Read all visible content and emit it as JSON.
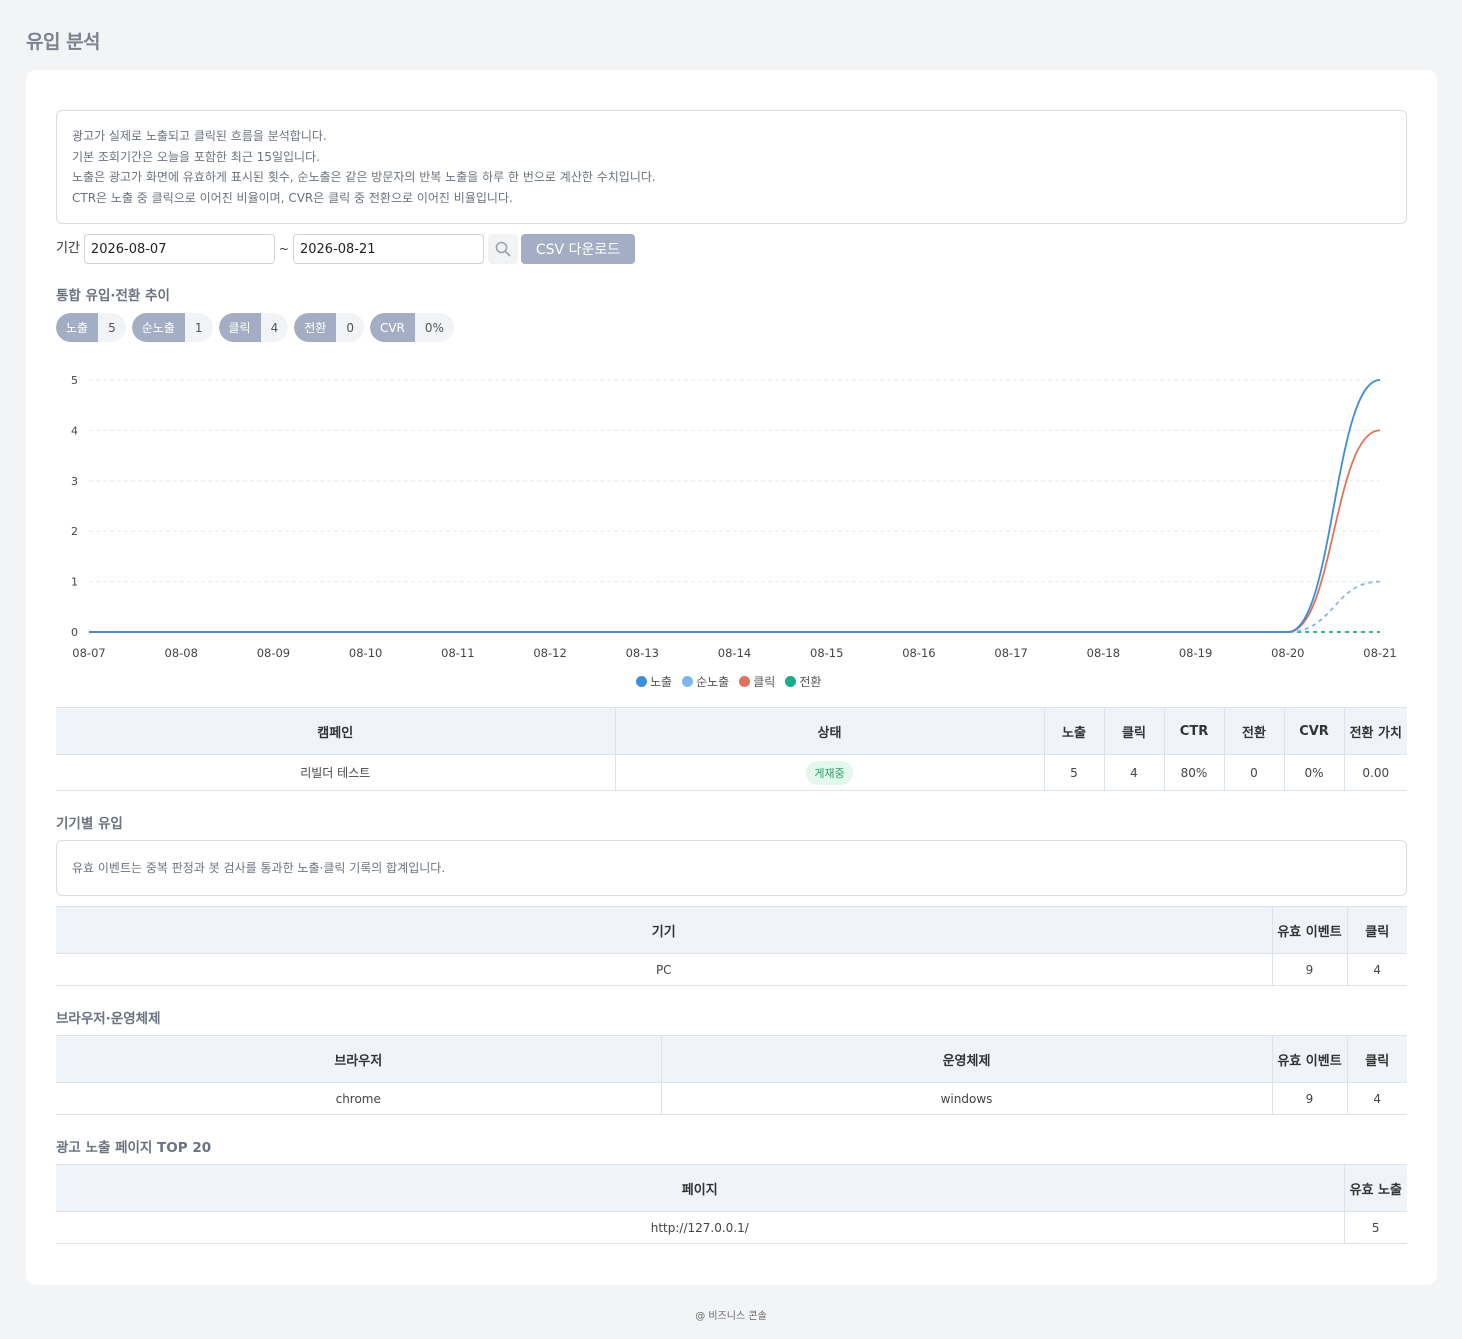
{
  "page_title": "유입 분석",
  "notice_lines": [
    "광고가 실제로 노출되고 클릭된 흐름을 분석합니다.",
    "기본 조회기간은 오늘을 포함한 최근 15일입니다.",
    "노출은 광고가 화면에 유효하게 표시된 횟수, 순노출은 같은 방문자의 반복 노출을 하루 한 번으로 계산한 수치입니다.",
    "CTR은 노출 중 클릭으로 이어진 비율이며, CVR은 클릭 중 전환으로 이어진 비율입니다."
  ],
  "filter": {
    "label": "기간",
    "start_date": "2026-08-07",
    "separator": "~",
    "end_date": "2026-08-21",
    "csv_label": "CSV 다운로드"
  },
  "trend": {
    "title": "통합 유입·전환 추이",
    "stats": [
      {
        "key": "노출",
        "value": "5"
      },
      {
        "key": "순노출",
        "value": "1"
      },
      {
        "key": "클릭",
        "value": "4"
      },
      {
        "key": "전환",
        "value": "0"
      },
      {
        "key": "CVR",
        "value": "0%"
      }
    ]
  },
  "chart_data": {
    "type": "line",
    "categories": [
      "08-07",
      "08-08",
      "08-09",
      "08-10",
      "08-11",
      "08-12",
      "08-13",
      "08-14",
      "08-15",
      "08-16",
      "08-17",
      "08-18",
      "08-19",
      "08-20",
      "08-21"
    ],
    "ylim": [
      0,
      5
    ],
    "yticks": [
      "0",
      "1",
      "2",
      "3",
      "4",
      "5"
    ],
    "grid": true,
    "legend_position": "bottom",
    "series": [
      {
        "name": "노출",
        "color": "#3a8fd8",
        "dashed": false,
        "values": [
          0,
          0,
          0,
          0,
          0,
          0,
          0,
          0,
          0,
          0,
          0,
          0,
          0,
          0,
          5
        ]
      },
      {
        "name": "순노출",
        "color": "#7db8ec",
        "dashed": true,
        "values": [
          0,
          0,
          0,
          0,
          0,
          0,
          0,
          0,
          0,
          0,
          0,
          0,
          0,
          0,
          1
        ]
      },
      {
        "name": "클릭",
        "color": "#e0735a",
        "dashed": false,
        "values": [
          0,
          0,
          0,
          0,
          0,
          0,
          0,
          0,
          0,
          0,
          0,
          0,
          0,
          0,
          4
        ]
      },
      {
        "name": "전환",
        "color": "#1aaa8c",
        "dashed": true,
        "values": [
          0,
          0,
          0,
          0,
          0,
          0,
          0,
          0,
          0,
          0,
          0,
          0,
          0,
          0,
          0
        ]
      }
    ]
  },
  "campaign_table": {
    "headers": [
      "캠페인",
      "상태",
      "노출",
      "클릭",
      "CTR",
      "전환",
      "CVR",
      "전환 가치"
    ],
    "row": {
      "campaign": "리빌더 테스트",
      "status": "게재중",
      "impressions": "5",
      "clicks": "4",
      "ctr": "80%",
      "conversions": "0",
      "cvr": "0%",
      "value": "0.00"
    }
  },
  "device": {
    "title": "기기별 유입",
    "notice": "유효 이벤트는 중복 판정과 봇 검사를 통과한 노출·클릭 기록의 합계입니다.",
    "headers": [
      "기기",
      "유효 이벤트",
      "클릭"
    ],
    "row": {
      "device": "PC",
      "events": "9",
      "clicks": "4"
    }
  },
  "browser": {
    "title": "브라우저·운영체제",
    "headers": [
      "브라우저",
      "운영체제",
      "유효 이벤트",
      "클릭"
    ],
    "row": {
      "browser": "chrome",
      "os": "windows",
      "events": "9",
      "clicks": "4"
    }
  },
  "pages": {
    "title": "광고 노출 페이지 TOP 20",
    "headers": [
      "페이지",
      "유효 노출"
    ],
    "row": {
      "page": "http://127.0.0.1/",
      "impressions": "5"
    }
  },
  "footer": "@ 비즈니스 콘솔"
}
